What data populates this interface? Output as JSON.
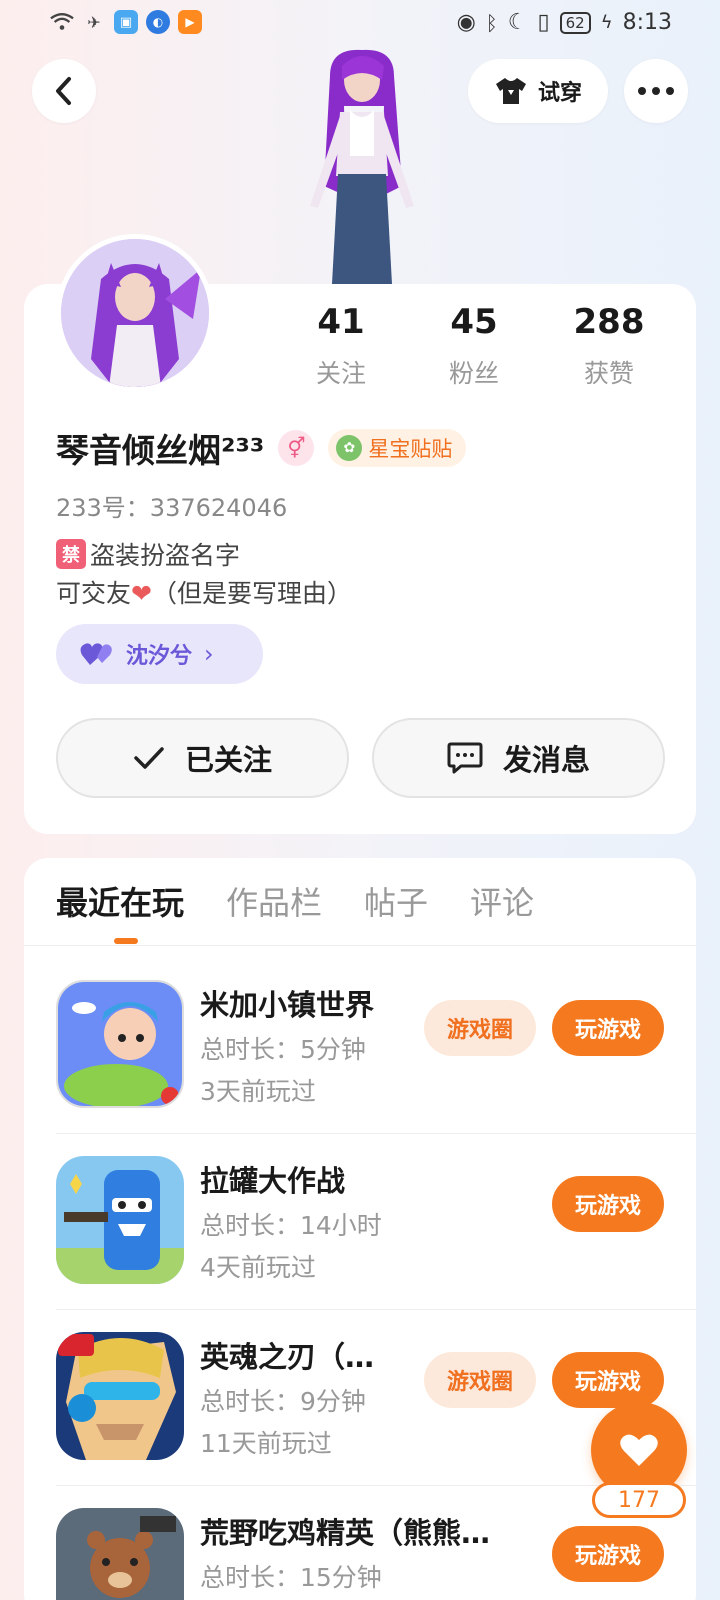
{
  "status_bar": {
    "time": "8:13",
    "battery": "62"
  },
  "header": {
    "try_on_label": "试穿"
  },
  "profile": {
    "stats": [
      {
        "value": "41",
        "label": "关注"
      },
      {
        "value": "45",
        "label": "粉丝"
      },
      {
        "value": "288",
        "label": "获赞"
      }
    ],
    "nickname": "琴音倾丝烟²³³",
    "gender_symbol": "⚥",
    "tag_label": "星宝贴贴",
    "uid_text": "233号：337624046",
    "bio_ban_char": "禁",
    "bio_line1": "盗装扮盗名字",
    "bio_line2_prefix": "可交友",
    "bio_heart": "❤",
    "bio_line2_suffix": "（但是要写理由）",
    "relation_name": "沈汐兮",
    "follow_label": "已关注",
    "message_label": "发消息"
  },
  "tabs": [
    "最近在玩",
    "作品栏",
    "帖子",
    "评论"
  ],
  "games": [
    {
      "title": "米加小镇世界",
      "time": "总时长：5分钟",
      "last": "3天前玩过",
      "circle": "游戏圈",
      "play": "玩游戏"
    },
    {
      "title": "拉罐大作战",
      "time": "总时长：14小时",
      "last": "4天前玩过",
      "circle": "",
      "play": "玩游戏"
    },
    {
      "title": "英魂之刃（…",
      "time": "总时长：9分钟",
      "last": "11天前玩过",
      "circle": "游戏圈",
      "play": "玩游戏"
    },
    {
      "title": "荒野吃鸡精英（熊熊…",
      "time": "总时长：15分钟",
      "last": "",
      "circle": "",
      "play": "玩游戏"
    }
  ],
  "like_count": "177",
  "colors": {
    "accent": "#f57a1f",
    "relation": "#6a58d9"
  }
}
